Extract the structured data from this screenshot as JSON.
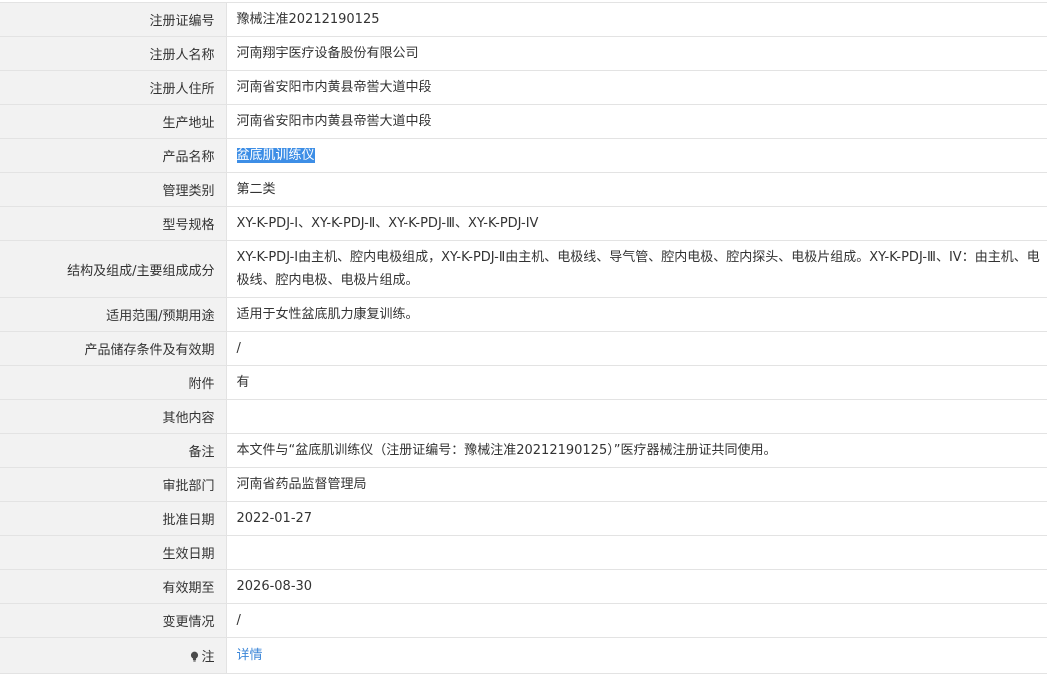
{
  "rows": [
    {
      "label": "注册证编号",
      "value": "豫械注准20212190125"
    },
    {
      "label": "注册人名称",
      "value": "河南翔宇医疗设备股份有限公司"
    },
    {
      "label": "注册人住所",
      "value": "河南省安阳市内黄县帝喾大道中段"
    },
    {
      "label": "生产地址",
      "value": "河南省安阳市内黄县帝喾大道中段"
    },
    {
      "label": "产品名称",
      "value": "盆底肌训练仪"
    },
    {
      "label": "管理类别",
      "value": "第二类"
    },
    {
      "label": "型号规格",
      "value": "XY-K-PDJ-Ⅰ、XY-K-PDJ-Ⅱ、XY-K-PDJ-Ⅲ、XY-K-PDJ-IV"
    },
    {
      "label": "结构及组成/主要组成成分",
      "value": "XY-K-PDJ-Ⅰ由主机、腔内电极组成，XY-K-PDJ-Ⅱ由主机、电极线、导气管、腔内电极、腔内探头、电极片组成。XY-K-PDJ-Ⅲ、IV：由主机、电极线、腔内电极、电极片组成。"
    },
    {
      "label": "适用范围/预期用途",
      "value": "适用于女性盆底肌力康复训练。"
    },
    {
      "label": "产品储存条件及有效期",
      "value": "/"
    },
    {
      "label": "附件",
      "value": "有"
    },
    {
      "label": "其他内容",
      "value": ""
    },
    {
      "label": "备注",
      "value": "本文件与“盆底肌训练仪（注册证编号：豫械注准20212190125）”医疗器械注册证共同使用。"
    },
    {
      "label": "审批部门",
      "value": "河南省药品监督管理局"
    },
    {
      "label": "批准日期",
      "value": "2022-01-27"
    },
    {
      "label": "生效日期",
      "value": ""
    },
    {
      "label": "有效期至",
      "value": "2026-08-30"
    },
    {
      "label": "变更情况",
      "value": "/"
    },
    {
      "label": "注",
      "value": "详情"
    }
  ],
  "icons": {
    "note": "bulb-icon"
  },
  "colors": {
    "selection": "#3d8ee6",
    "link": "#3b86d8",
    "label_bg": "#f2f2f2"
  }
}
